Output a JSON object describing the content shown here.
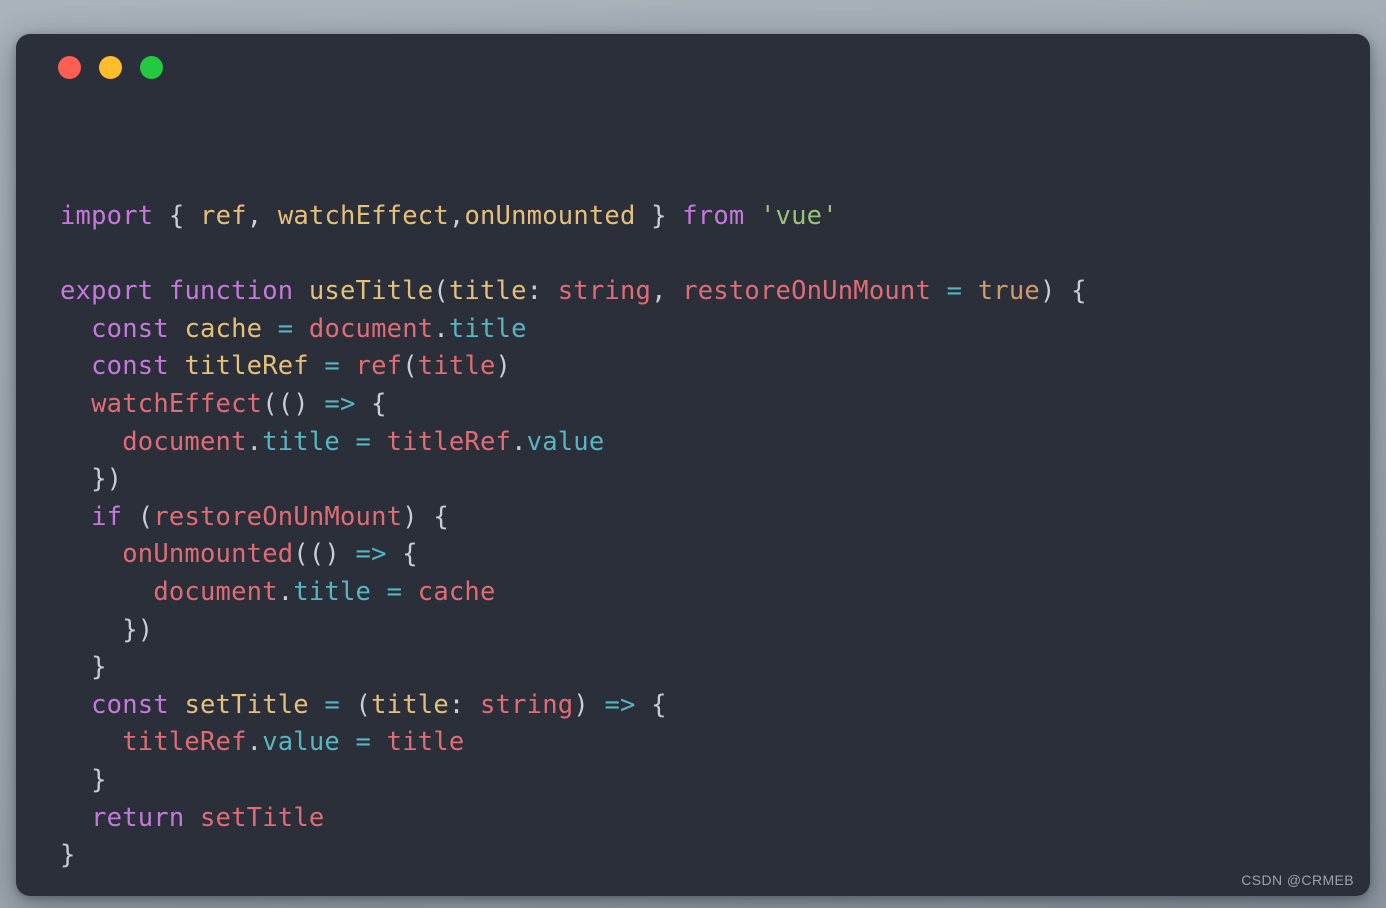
{
  "window": {
    "controls": [
      {
        "name": "close",
        "color": "#ff5f52"
      },
      {
        "name": "minimize",
        "color": "#ffbd2e"
      },
      {
        "name": "maximize",
        "color": "#23ca3f"
      }
    ]
  },
  "theme": {
    "page_background": "#a4acb5",
    "card_background": "#2b2f3a",
    "default_text": "#c9cdd4",
    "keyword": "#c678dd",
    "function": "#e5c07b",
    "variable": "#e06c75",
    "property": "#56b6c2",
    "operator": "#56b6c2",
    "string": "#98c379",
    "number": "#d19a66"
  },
  "code": {
    "language": "typescript",
    "lines": [
      "import { ref, watchEffect,onUnmounted } from 'vue'",
      "",
      "export function useTitle(title: string, restoreOnUnMount = true) {",
      "  const cache = document.title",
      "  const titleRef = ref(title)",
      "  watchEffect(() => {",
      "    document.title = titleRef.value",
      "  })",
      "  if (restoreOnUnMount) {",
      "    onUnmounted(() => {",
      "      document.title = cache",
      "    })",
      "  }",
      "  const setTitle = (title: string) => {",
      "    titleRef.value = title",
      "  }",
      "  return setTitle",
      "}"
    ],
    "plain_text": "import { ref, watchEffect,onUnmounted } from 'vue'\n\nexport function useTitle(title: string, restoreOnUnMount = true) {\n  const cache = document.title\n  const titleRef = ref(title)\n  watchEffect(() => {\n    document.title = titleRef.value\n  })\n  if (restoreOnUnMount) {\n    onUnmounted(() => {\n      document.title = cache\n    })\n  }\n  const setTitle = (title: string) => {\n    titleRef.value = title\n  }\n  return setTitle\n}"
  },
  "watermark": {
    "text": "CSDN @CRMEB"
  }
}
